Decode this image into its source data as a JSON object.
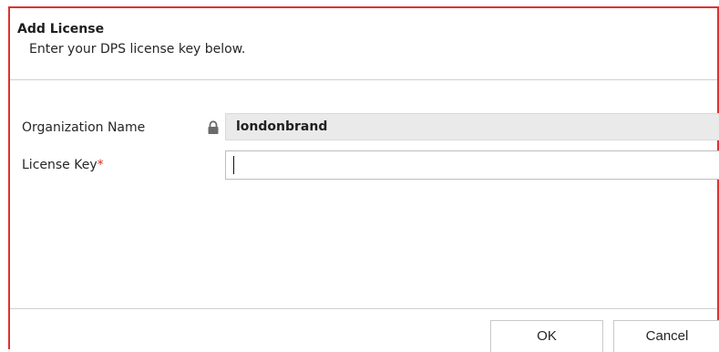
{
  "dialog": {
    "title": "Add License",
    "subtitle": "Enter your DPS license key below."
  },
  "form": {
    "org_label": "Organization Name",
    "org_value": "londonbrand",
    "key_label": "License Key",
    "required_marker": "*",
    "key_value": ""
  },
  "buttons": {
    "ok_label": "OK",
    "cancel_label": "Cancel"
  },
  "icons": {
    "lock": "lock-icon"
  },
  "colors": {
    "border_accent": "#e0312f",
    "required": "#d9291e",
    "readonly_bg": "#eaeaea"
  }
}
